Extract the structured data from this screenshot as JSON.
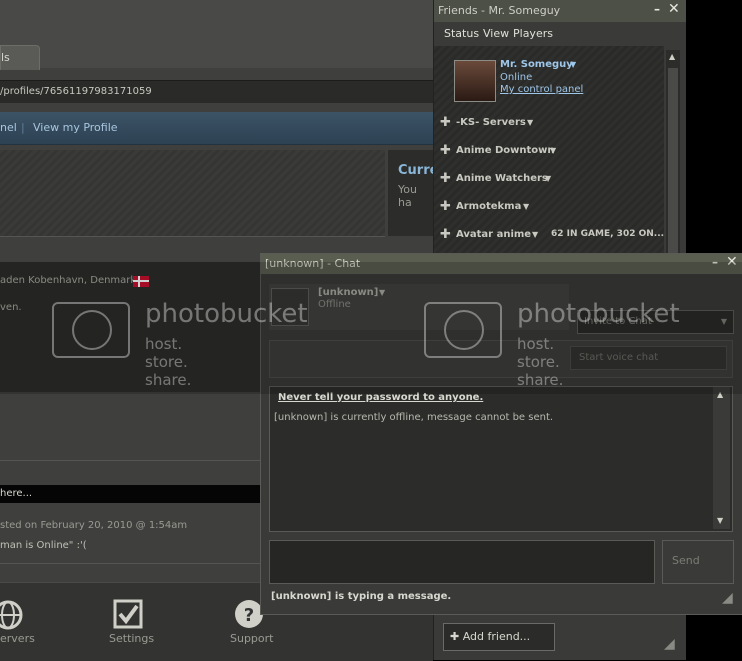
{
  "browser": {
    "tab_label": "ls",
    "address": "/profiles/76561197983171059",
    "nav": [
      "nel",
      "|",
      "View my Profile"
    ],
    "current_title": "Curre",
    "current_sub": "You ha",
    "location": "aden Kobenhavn, Denmark",
    "bio": "ven.",
    "comment_placeholder": "here...",
    "posted": "sted on February 20, 2010 @ 1:54am",
    "status_comment": "man is Online\" :'(",
    "bottom": {
      "servers": "ervers",
      "settings": "Settings",
      "support": "Support"
    }
  },
  "friends": {
    "title": "Friends - Mr. Someguy",
    "menu": [
      "Status",
      "View",
      "Players"
    ],
    "me": {
      "name": "Mr. Someguy",
      "status": "Online",
      "control_panel": "My control panel"
    },
    "groups": [
      "-KS- Servers",
      "Anime Downtown",
      "Anime Watchers",
      "Armotekma",
      "Avatar anime"
    ],
    "ingame_count": "62 IN GAME, 302 ON...",
    "add_friend": "Add friend..."
  },
  "chat": {
    "title": "[unknown] - Chat",
    "user": {
      "name": "[unknown]",
      "status": "Offline"
    },
    "invite": "Invite to Chat",
    "voice": "Start voice chat",
    "warning": "Never tell your password to anyone.",
    "offline_msg": "[unknown] is currently offline, message cannot be sent.",
    "send": "Send",
    "typing": "[unknown] is typing a message."
  },
  "watermark": {
    "brand": "photobucket",
    "tagline": "host. store. share."
  },
  "colors": {
    "nav_link": "#a9c6de",
    "title_bar": "#4c5046"
  }
}
